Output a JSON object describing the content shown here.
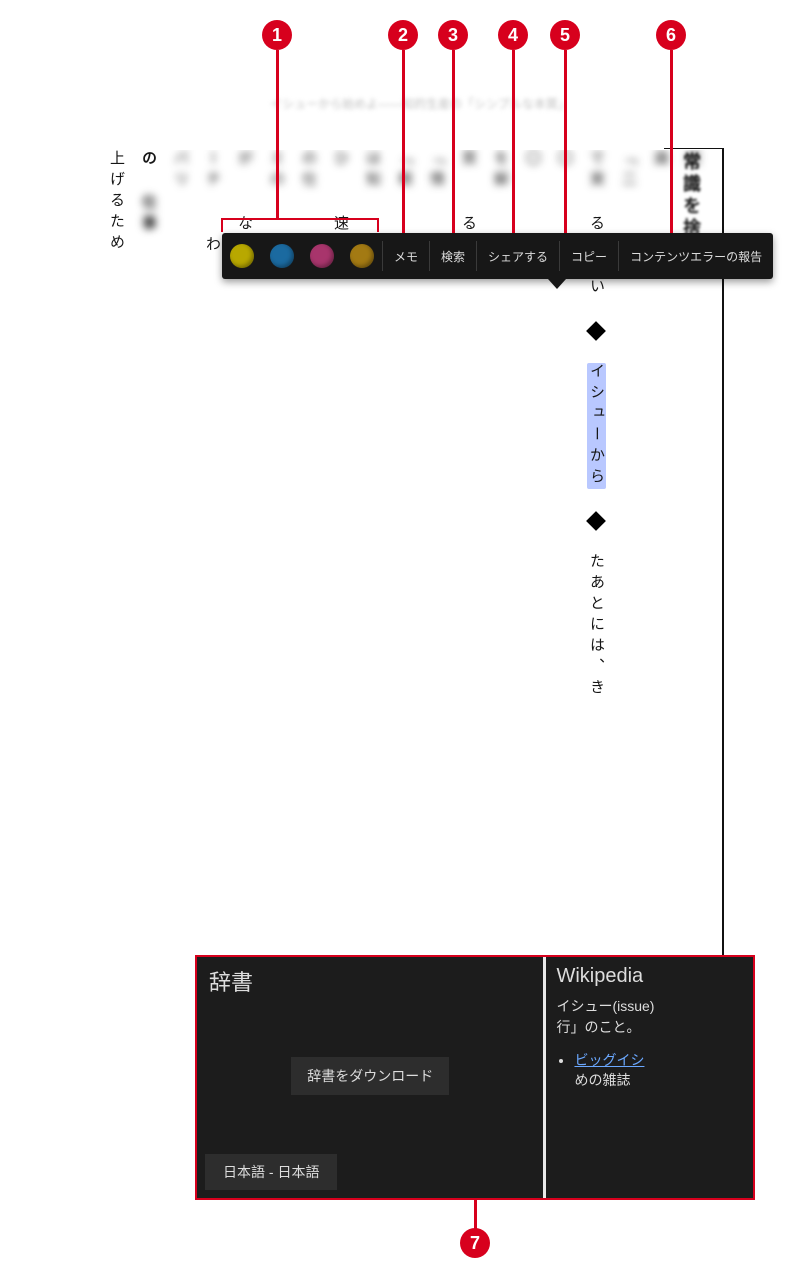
{
  "callouts": {
    "1": "1",
    "2": "2",
    "3": "3",
    "4": "4",
    "5": "5",
    "6": "6",
    "7": "7"
  },
  "page": {
    "header_blurred": "イシューから始めよ――知的生産の「シンプルな本質」",
    "section_head": "常識を捨",
    "selection": {
      "text": "イシューから",
      "prefix_above": "る」とい",
      "suffix_below": "たあとには、き"
    },
    "columns_blurred": [
      "紹",
      "識",
      "「二",
      "で実",
      "〇",
      "〇",
      "を解",
      "質",
      "「情",
      "「根",
      "は知",
      "ひ",
      "の仕",
      "ミの",
      "が",
      "ーチ",
      "バリ",
      "の",
      "〇",
      "「",
      "「実"
    ],
    "tail_subhead": "上げるため",
    "tail_bold": "仕事"
  },
  "context_toolbar": {
    "highlight_colors": [
      "yellow",
      "blue",
      "magenta",
      "olive"
    ],
    "memo": "メモ",
    "search": "検索",
    "share": "シェアする",
    "copy": "コピー",
    "report": "コンテンツエラーの報告"
  },
  "panel": {
    "dictionary": {
      "title": "辞書",
      "download_button": "辞書をダウンロード",
      "language_button": "日本語 - 日本語"
    },
    "wikipedia": {
      "title": "Wikipedia",
      "summary_prefix": "イシュー(issue)",
      "summary_suffix": "行」のこと。",
      "link_text": "ビッグイシ",
      "bullet_tail": "めの雑誌"
    }
  }
}
